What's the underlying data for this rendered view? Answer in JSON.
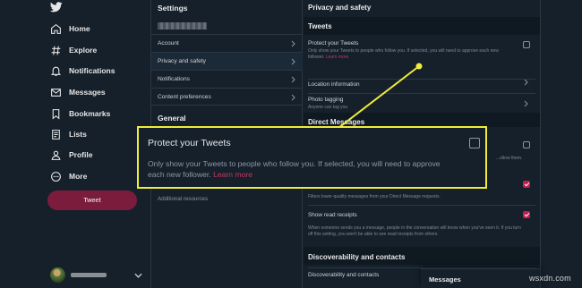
{
  "nav": {
    "items": [
      {
        "label": "Home",
        "icon": "home-icon"
      },
      {
        "label": "Explore",
        "icon": "hashtag-icon"
      },
      {
        "label": "Notifications",
        "icon": "bell-icon"
      },
      {
        "label": "Messages",
        "icon": "envelope-icon"
      },
      {
        "label": "Bookmarks",
        "icon": "bookmark-icon"
      },
      {
        "label": "Lists",
        "icon": "list-icon"
      },
      {
        "label": "Profile",
        "icon": "person-icon"
      },
      {
        "label": "More",
        "icon": "more-icon"
      }
    ],
    "tweet_button": "Tweet",
    "accent": "#7b1c3d"
  },
  "settings": {
    "title": "Settings",
    "rows": [
      "Account",
      "Privacy and safety",
      "Notifications",
      "Content preferences"
    ],
    "general_title": "General",
    "additional_resources": "Additional resources"
  },
  "privacy": {
    "title": "Privacy and safety",
    "tweets_header": "Tweets",
    "protect": {
      "title": "Protect your Tweets",
      "desc": "Only show your Tweets to people who follow you. If selected, you will need to approve each new follower.",
      "learn_more": "Learn more"
    },
    "location": {
      "title": "Location information"
    },
    "photo": {
      "title": "Photo tagging",
      "desc": "Anyone can tag you"
    },
    "direct_messages_header": "Direct Messages",
    "dm_partial": "...ollow them.",
    "filter_desc": "Filters lower-quality messages from your Direct Message requests.",
    "read_receipts": {
      "title": "Show read receipts",
      "desc": "When someone sends you a message, people in the conversation will know when you've seen it. If you turn off this setting, you won't be able to see read receipts from others."
    },
    "discover_header": "Discoverability and contacts",
    "discover_row": "Discoverability and contacts"
  },
  "messages_bar": {
    "label": "Messages"
  },
  "callout": {
    "title": "Protect your Tweets",
    "desc": "Only show your Tweets to people who follow you. If selected, you will need to approve each new follower.",
    "learn_more": "Learn more",
    "highlight_color": "#f0ec3b"
  },
  "watermark": "wsxdn.com"
}
